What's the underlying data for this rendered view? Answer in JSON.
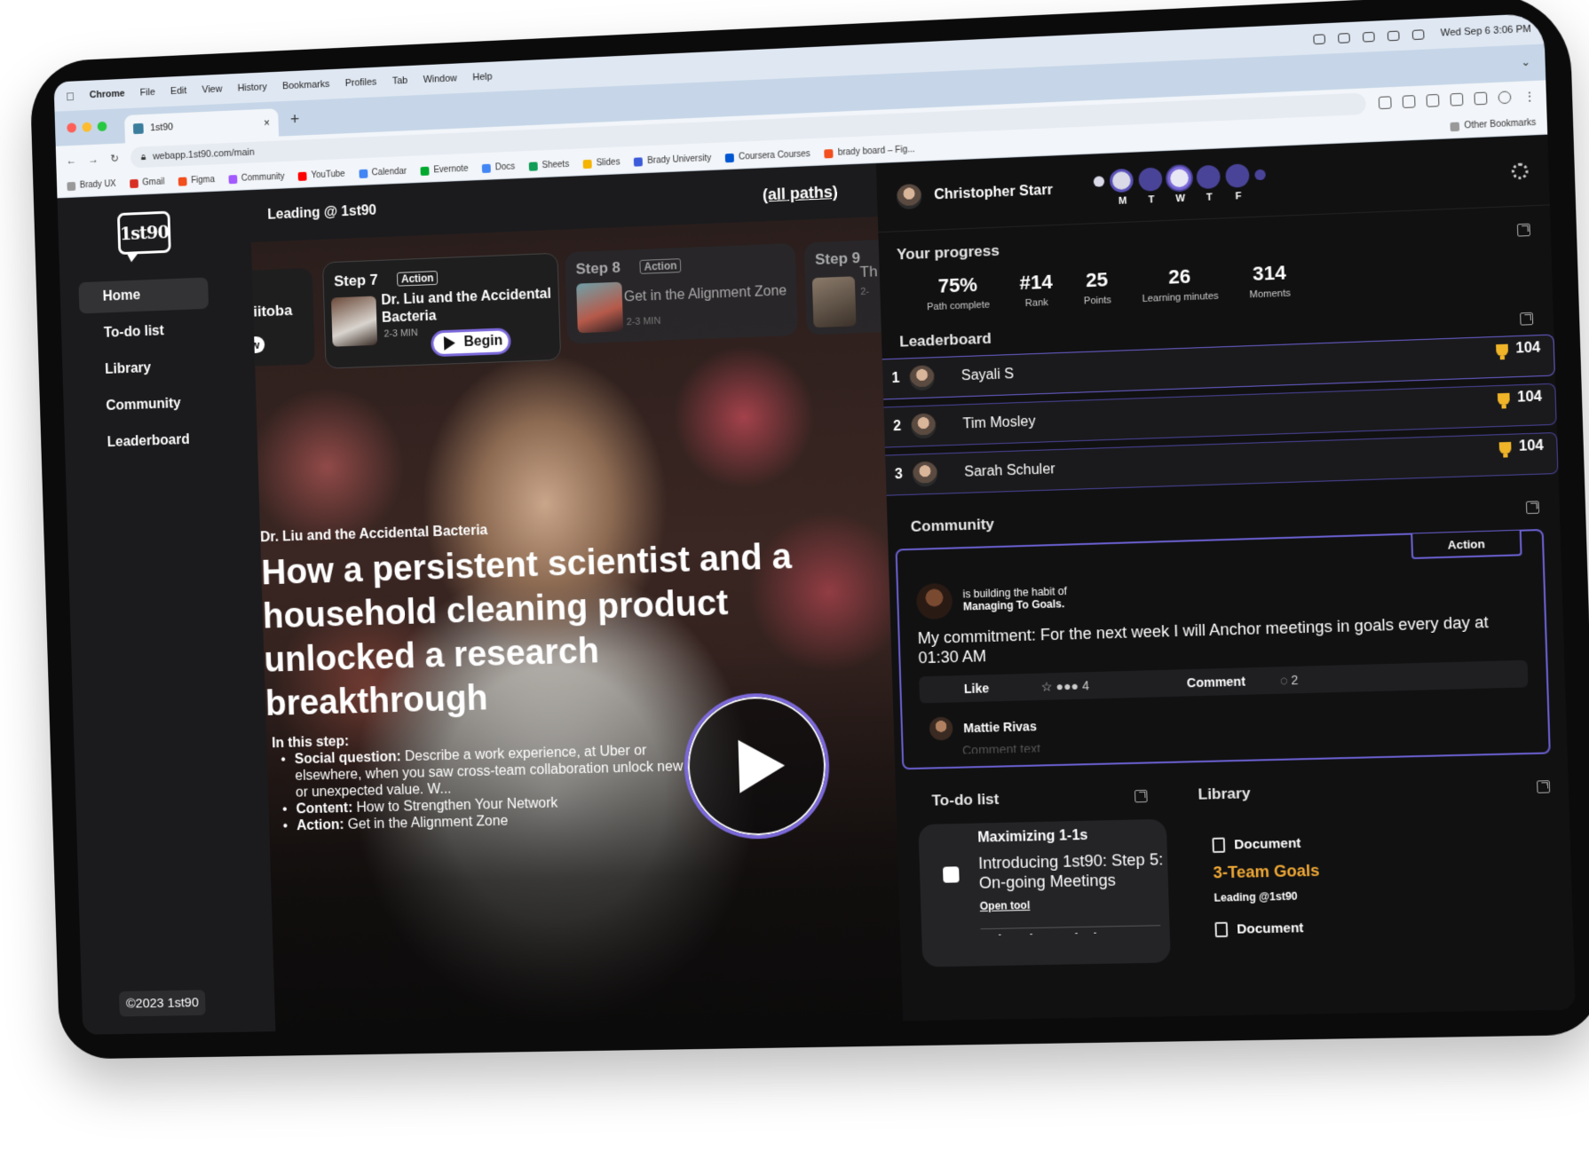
{
  "menubar": {
    "items": [
      "Chrome",
      "File",
      "Edit",
      "View",
      "History",
      "Bookmarks",
      "Profiles",
      "Tab",
      "Window",
      "Help"
    ],
    "clock": "Wed Sep 6  3:06 PM"
  },
  "browser": {
    "tab_title": "1st90",
    "url": "webapp.1st90.com/main",
    "other_bookmarks": "Other Bookmarks",
    "bookmarks": [
      "Brady UX",
      "Gmail",
      "Figma",
      "Community",
      "YouTube",
      "Calendar",
      "Evernote",
      "Docs",
      "Sheets",
      "Slides",
      "Brady University",
      "Coursera Courses",
      "brady board – Fig..."
    ]
  },
  "sidebar": {
    "logo": "1st90",
    "items": [
      {
        "label": "Home",
        "active": true
      },
      {
        "label": "To-do list"
      },
      {
        "label": "Library"
      },
      {
        "label": "Community"
      },
      {
        "label": "Leaderboard"
      }
    ],
    "copyright": "©2023 1st90"
  },
  "main": {
    "header_title": "Leading @ 1st90",
    "all_paths": "(all paths)",
    "prev_card": {
      "title": "iitoba",
      "badge": "w"
    },
    "current_step": {
      "step": "Step 7",
      "tag": "Action",
      "title": "Dr. Liu and the Accidental Bacteria",
      "duration": "2-3 MIN",
      "button": "Begin"
    },
    "next_step": {
      "step": "Step 8",
      "tag": "Action",
      "title": "Get in the Alignment Zone",
      "duration": "2-3 MIN"
    },
    "next_step_2": {
      "step": "Step 9",
      "title": "Th",
      "duration": "2-"
    },
    "hero": {
      "kicker": "Dr. Liu and the Accidental Bacteria",
      "headline": "How a persistent scientist and a household cleaning product unlocked a research breakthrough",
      "in_this_step": "In this step:",
      "bullets": [
        {
          "label": "Social question:",
          "text": " Describe a work experience, at Uber or elsewhere, when you saw cross-team collaboration unlock new or unexpected value. W..."
        },
        {
          "label": "Content:",
          "text": " How to Strengthen Your Network"
        },
        {
          "label": "Action:",
          "text": " Get in the Alignment Zone"
        }
      ]
    }
  },
  "right": {
    "user": {
      "name": "Christopher Starr"
    },
    "week_days": [
      "M",
      "T",
      "W",
      "T",
      "F"
    ],
    "progress": {
      "title": "Your progress",
      "stats": [
        {
          "value": "75%",
          "label": "Path complete"
        },
        {
          "value": "#14",
          "label": "Rank"
        },
        {
          "value": "25",
          "label": "Points"
        },
        {
          "value": "26",
          "label": "Learning minutes"
        },
        {
          "value": "314",
          "label": "Moments"
        }
      ]
    },
    "leaderboard": {
      "title": "Leaderboard",
      "rows": [
        {
          "rank": "1",
          "name": "Sayali S",
          "score": "104"
        },
        {
          "rank": "2",
          "name": "Tim Mosley",
          "score": "104"
        },
        {
          "rank": "3",
          "name": "Sarah Schuler",
          "score": "104"
        }
      ]
    },
    "community": {
      "title": "Community",
      "tag": "Action",
      "habit_prefix": "is building the habit of",
      "habit": "Managing To Goals.",
      "commitment": "My commitment: For the next week I will Anchor meetings in goals every day at 01:30 AM",
      "like": "Like",
      "like_count": "4",
      "comment": "Comment",
      "comment_count": "2",
      "commenter": "Mattie Rivas",
      "comment_placeholder": "Comment text"
    },
    "todo": {
      "title": "To-do list",
      "item_heading": "Maximizing 1-1s",
      "item_text": "Introducing 1st90: Step 5: On-going Meetings",
      "item_link": "Open tool",
      "next_item": "Delegating Actively"
    },
    "library": {
      "title": "Library",
      "items": [
        {
          "type": "Document",
          "title": "3-Team Goals",
          "sub": "Leading @1st90"
        },
        {
          "type": "Document"
        }
      ]
    }
  }
}
